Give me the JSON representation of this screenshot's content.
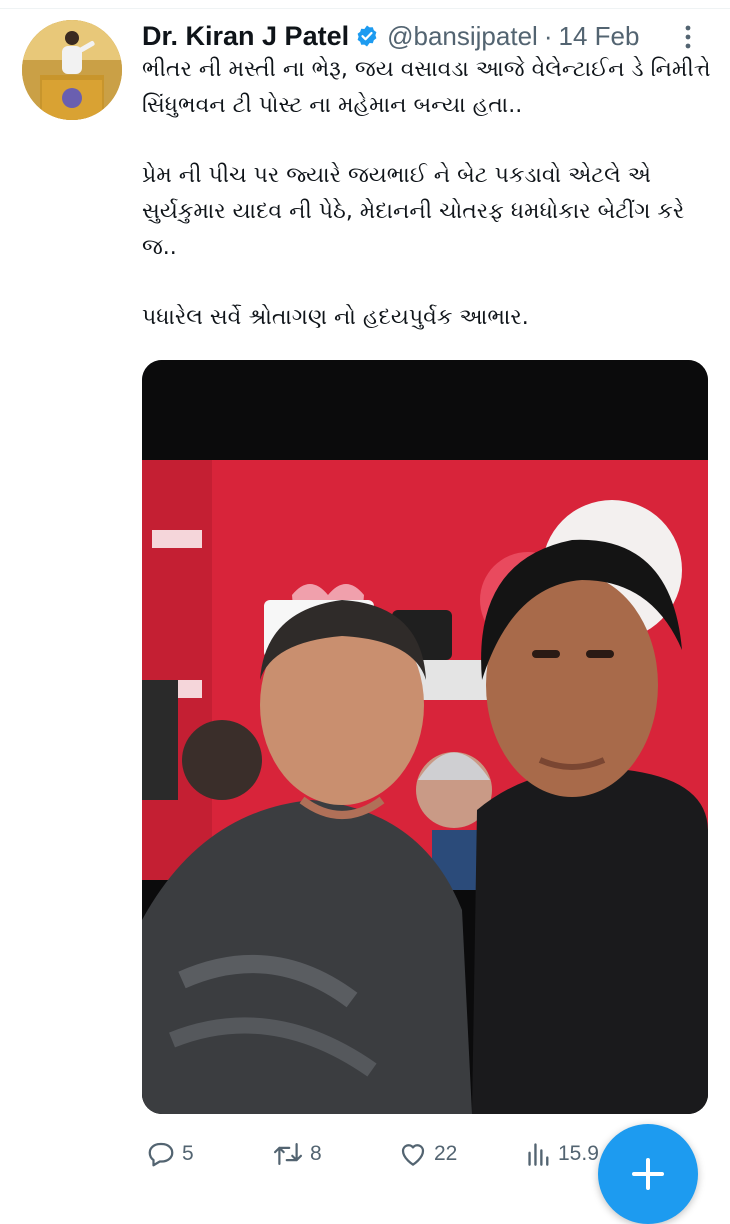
{
  "tweet": {
    "author_name": "Dr. Kiran J Patel",
    "author_handle": "@bansijpatel",
    "separator": "·",
    "date": "14 Feb",
    "paragraphs": [
      "ભીતર ની મસ્તી ના ભેરૂ, જય વસાવડા આજે  વેલેન્ટાઈન ડે નિમીત્તે સિંધુભવન ટી પોસ્ટ ના મહેમાન બન્યા હતા..",
      "પ્રેમ ની પીચ પર  જ્યારે જયભાઈ ને બેટ પકડાવો એટલે એ સુર્યકુમાર યાદવ ની પેઠે, મેદાનની ચોતરફ ધમધોકાર બેટીંગ કરે જ..",
      "પધારેલ સર્વે શ્રોતાગણ નો હદયપુર્વક આભાર."
    ]
  },
  "stats": {
    "replies": "5",
    "retweets": "8",
    "likes": "22",
    "views": "15.9"
  },
  "colors": {
    "verified_badge": "#1d9bf0",
    "fab": "#1d9bf0",
    "secondary_text": "#536471",
    "backdrop_red": "#d8243a"
  },
  "icons": [
    "verified-badge-icon",
    "more-options-icon",
    "reply-icon",
    "retweet-icon",
    "like-icon",
    "views-icon",
    "compose-plus-icon"
  ]
}
